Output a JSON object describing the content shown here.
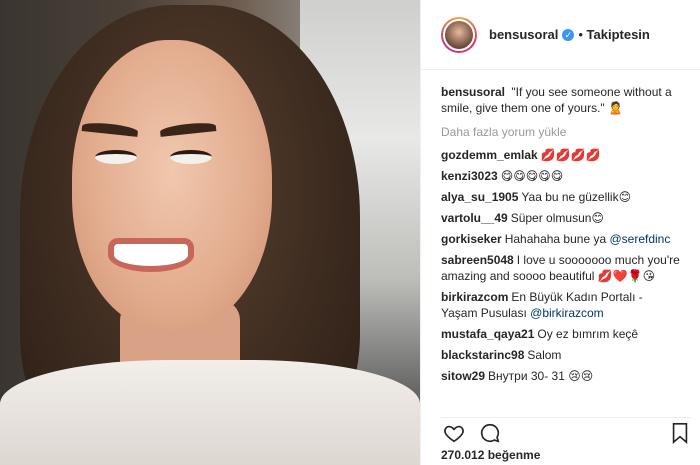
{
  "post": {
    "username": "bensusoral",
    "verified_mark": "✓",
    "follow_status": "Takiptesin",
    "caption": "\"If you see someone without a smile, give them one of yours.\"",
    "caption_emoji": "🙎",
    "load_more": "Daha fazla yorum yükle",
    "likes": "270.012 beğenme"
  },
  "comments": [
    {
      "user": "gozdemm_emlak",
      "text": "",
      "emoji": "💋💋💋💋"
    },
    {
      "user": "kenzi3023",
      "text": "",
      "emoji": "😋😋😋😋😋"
    },
    {
      "user": "alya_su_1905",
      "text": "Yaa bu ne güzellik",
      "emoji": "😊"
    },
    {
      "user": "vartolu__49",
      "text": "Süper olmusun",
      "emoji": "😊"
    },
    {
      "user": "gorkiseker",
      "text": "Hahahaha bune ya ",
      "mention": "@serefdinc",
      "emoji": ""
    },
    {
      "user": "sabreen5048",
      "text": "I love u sooooooo much you're amazing and soooo beautiful ",
      "emoji": "💋❤️🌹😘"
    },
    {
      "user": "birkirazcom",
      "text": "En Büyük Kadın Portalı - Yaşam Pusulası ",
      "mention": "@birkirazcom",
      "emoji": ""
    },
    {
      "user": "mustafa_qaya21",
      "text": "Oy ez bımrım keçê",
      "emoji": ""
    },
    {
      "user": "blackstarinc98",
      "text": "Salom",
      "emoji": ""
    },
    {
      "user": "sitow29",
      "text": "Внутри 30- 31 ",
      "emoji": "😢😢"
    }
  ],
  "icons": [
    "heart-icon",
    "comment-icon",
    "bookmark-icon"
  ]
}
